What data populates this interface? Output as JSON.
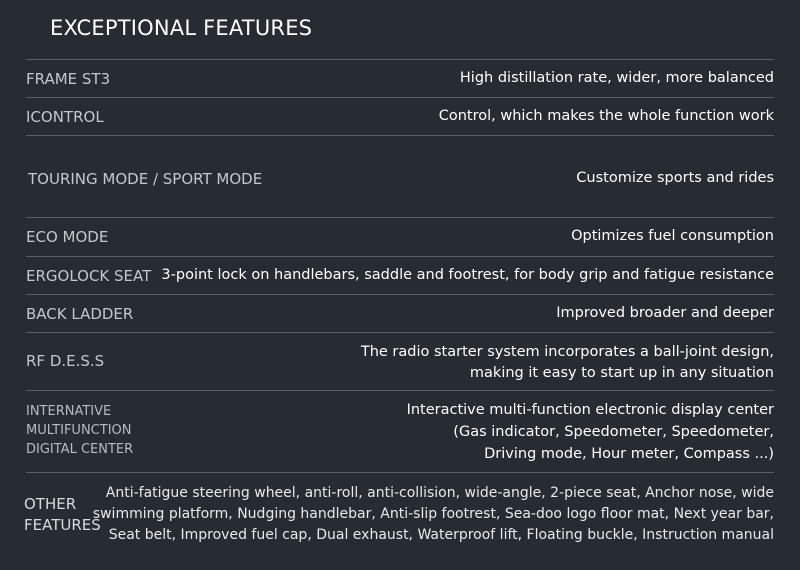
{
  "title": "EXCEPTIONAL FEATURES",
  "features": [
    {
      "label": "FRAME ST3",
      "value": [
        "High distillation rate, wider, more balanced"
      ]
    },
    {
      "label": "ICONTROL",
      "value": [
        "Control, which makes the whole function work"
      ]
    },
    {
      "label": "TOURING MODE / SPORT MODE",
      "value": [
        "Customize sports and rides"
      ]
    },
    {
      "label": "ECO MODE",
      "value": [
        "Optimizes fuel consumption"
      ]
    },
    {
      "label": "ERGOLOCK SEAT",
      "value": [
        "3-point lock on handlebars, saddle and footrest, for body grip and fatigue resistance"
      ]
    },
    {
      "label": "BACK LADDER",
      "value": [
        "Improved broader and deeper"
      ]
    },
    {
      "label": "RF D.E.S.S",
      "value": [
        "The radio starter system incorporates a ball-joint design,",
        "making it easy to start up in any situation"
      ]
    },
    {
      "label": [
        "INTERNATIVE",
        "MULTIFUNCTION",
        "DIGITAL CENTER"
      ],
      "value": [
        "Interactive multi-function electronic display center",
        "(Gas indicator, Speedometer, Speedometer,",
        "Driving mode, Hour meter, Compass ...)"
      ]
    },
    {
      "label": [
        "OTHER",
        "FEATURES"
      ],
      "value": [
        "Anti-fatigue steering wheel, anti-roll, anti-collision, wide-angle, 2-piece seat, Anchor nose, wide",
        "swimming platform, Nudging handlebar, Anti-slip footrest, Sea-doo logo floor mat, Next year bar,",
        "Seat belt, Improved fuel cap, Dual exhaust, Waterproof lift, Floating buckle, Instruction manual"
      ]
    }
  ]
}
